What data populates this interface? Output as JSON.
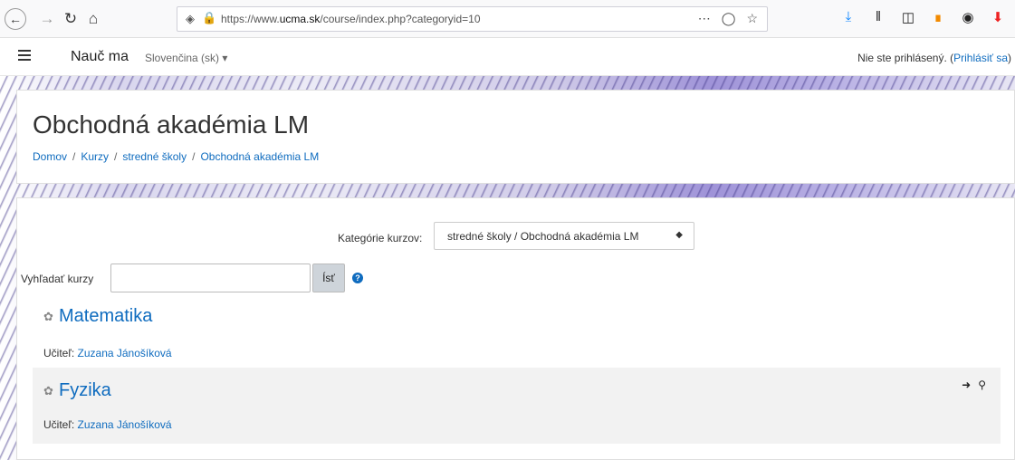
{
  "browser": {
    "url_prefix": "https://www.",
    "url_domain": "ucma.sk",
    "url_path": "/course/index.php?categoryid=10",
    "icons": [
      "back-icon",
      "forward-icon",
      "reload-icon",
      "home-icon",
      "shield-icon",
      "lock-icon",
      "more-icon",
      "pocket-icon",
      "star-icon",
      "download-icon",
      "library-icon",
      "sidebar-icon",
      "rss-icon",
      "account-icon",
      "pdf-download-icon",
      "extension-icon"
    ]
  },
  "navbar": {
    "site_name": "Nauč ma",
    "language": "Slovenčina (sk)",
    "login_text": "Nie ste prihlásený. (",
    "login_link": "Prihlásiť sa",
    "login_close": ")"
  },
  "header": {
    "title": "Obchodná akadémia LM",
    "breadcrumb": [
      {
        "label": "Domov"
      },
      {
        "label": "Kurzy"
      },
      {
        "label": "stredné školy"
      },
      {
        "label": "Obchodná akadémia LM"
      }
    ],
    "separator": "/"
  },
  "main": {
    "category_label": "Kategórie kurzov:",
    "category_selected": "stredné školy / Obchodná akadémia LM",
    "search_label": "Vyhľadať kurzy",
    "search_value": "",
    "go_button": "Ísť",
    "courses": [
      {
        "name": "Matematika",
        "teacher_label": "Učiteľ:",
        "teacher": "Zuzana Jánošíková"
      },
      {
        "name": "Fyzika",
        "teacher_label": "Učiteľ:",
        "teacher": "Zuzana Jánošíková"
      }
    ]
  },
  "colors": {
    "link": "#0f6cbf",
    "highlight_row": "#f2f2f2"
  }
}
